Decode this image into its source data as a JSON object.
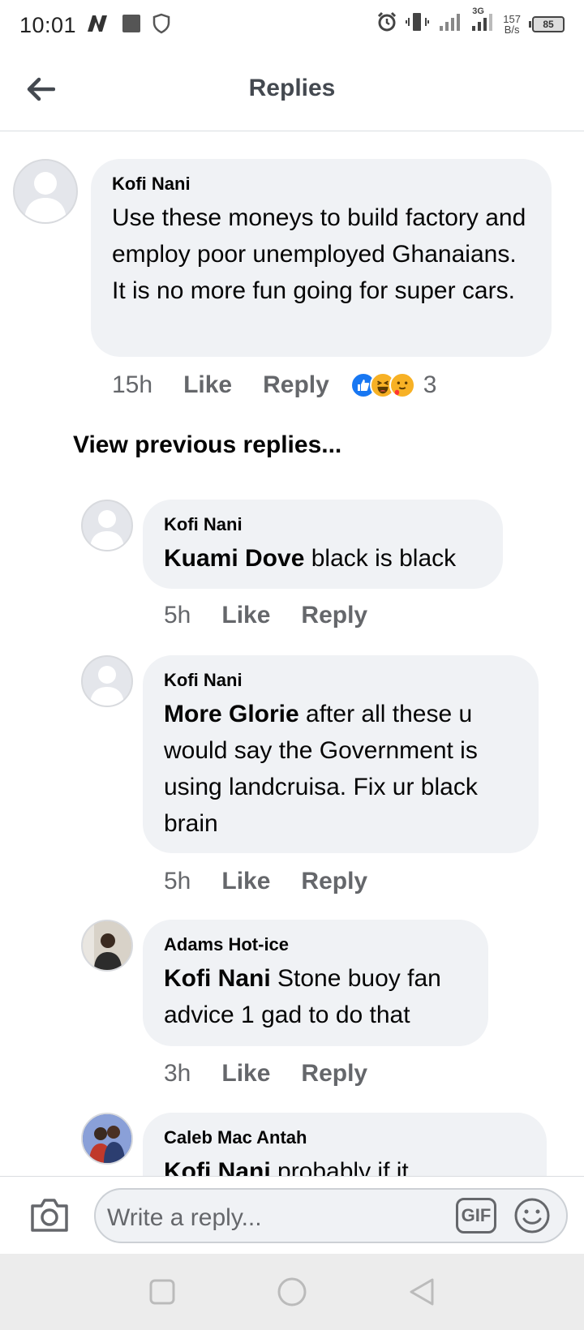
{
  "status_bar": {
    "time": "10:01",
    "net_speed_value": "157",
    "net_speed_unit": "B/s",
    "network_type": "3G",
    "battery": "85"
  },
  "header": {
    "title": "Replies"
  },
  "main_comment": {
    "author": "Kofi Nani",
    "text": "Use these moneys to build factory and employ poor unemployed Ghanaians. It is no more fun going for super cars.",
    "time": "15h",
    "like_label": "Like",
    "reply_label": "Reply",
    "reaction_count": "3"
  },
  "view_previous": "View previous replies...",
  "replies": [
    {
      "author": "Kofi Nani",
      "mention": "Kuami Dove",
      "text": " black is black",
      "time": "5h",
      "like_label": "Like",
      "reply_label": "Reply"
    },
    {
      "author": "Kofi Nani",
      "mention": "More Glorie",
      "text": " after all these u would say the Government is using landcruisa. Fix ur black brain",
      "time": "5h",
      "like_label": "Like",
      "reply_label": "Reply"
    },
    {
      "author": "Adams Hot-ice",
      "mention": "Kofi Nani",
      "text": " Stone buoy fan advice 1 gad to do that",
      "time": "3h",
      "like_label": "Like",
      "reply_label": "Reply"
    },
    {
      "author": "Caleb Mac Antah",
      "mention": "Kofi Nani",
      "text": "  probably if it"
    }
  ],
  "composer": {
    "placeholder": "Write a reply...",
    "gif_label": "GIF"
  },
  "colors": {
    "bubble": "#f0f2f5",
    "secondary_text": "#65676b",
    "like_blue": "#1877f2"
  },
  "icons": {
    "back": "arrow-left-icon",
    "camera": "camera-icon",
    "emoji": "smiley-icon"
  }
}
